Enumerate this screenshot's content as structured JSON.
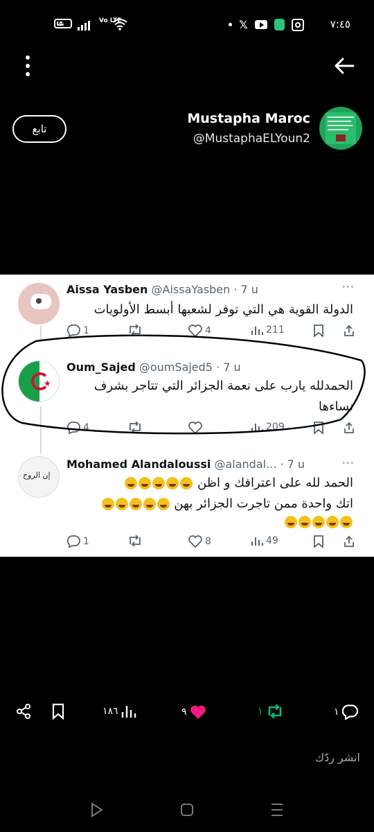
{
  "status_bar": {
    "time": "٧:٤٥",
    "battery": "٤٤",
    "network": "Vo LTE"
  },
  "profile": {
    "name": "Mustapha Maroc",
    "handle": "@MustaphaELYoun2",
    "follow_label": "تابع"
  },
  "tweets": [
    {
      "name": "Aissa Yasben",
      "handle": "@AissaYasben",
      "time": "· 7 u",
      "text": "الدولة القوية هي التي توفر لشعبها أبسط الأولويات",
      "replies": "1",
      "likes": "4",
      "views": "211"
    },
    {
      "name": "Oum_Sajed",
      "handle": "@oumSajed5",
      "time": "· 7 u",
      "text_line1": "الحمدلله يارب على نعمة الجزائر التي تتاجر بشرف",
      "text_line2": "نساءها",
      "replies": "4",
      "views": "209"
    },
    {
      "name": "Mohamed Alandaloussi",
      "handle": "@alandal...",
      "time": "· 7 u",
      "text_line1": "الحمد لله على اعترافك و اظن",
      "text_line2": "اتك واحدة ممن تاجرت الجزائر بهن",
      "replies": "1",
      "likes": "8",
      "views": "49",
      "avatar_text": "إن الروح"
    }
  ],
  "bottom_bar": {
    "reply_count": "١",
    "retweet_count": "١",
    "like_count": "٩",
    "views_count": "١٨٦"
  },
  "reply_placeholder": "انشر ردّك",
  "colors": {
    "like_pink": "#f91880",
    "retweet_green": "#00ba7c",
    "muted_gray": "#536471"
  }
}
